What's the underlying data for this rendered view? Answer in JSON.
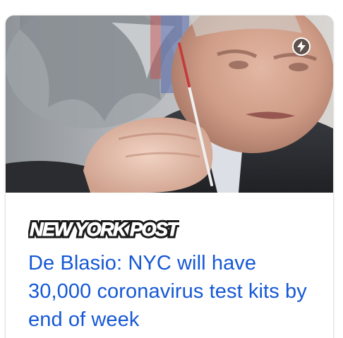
{
  "card": {
    "source": {
      "name": "NEW YORK POST",
      "logo_icon": "new-york-post-logo"
    },
    "headline": "De Blasio: NYC will have 30,000 coronavirus test kits by end of week",
    "thumbnail": {
      "badge_icon": "amp-lightning-icon"
    }
  },
  "colors": {
    "headline": "#1558d6",
    "badge_bg": "#323232",
    "card_bg": "#ffffff"
  }
}
